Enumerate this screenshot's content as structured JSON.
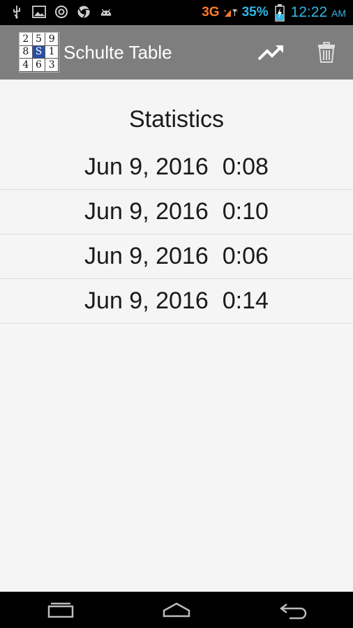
{
  "status_bar": {
    "network": "3G",
    "battery_percent": "35%",
    "time": "12:22",
    "ampm": "AM",
    "icons": [
      "usb-icon",
      "image-icon",
      "at-icon",
      "chrome-icon",
      "android-icon",
      "signal-icon",
      "battery-icon"
    ]
  },
  "action_bar": {
    "title": "Schulte Table",
    "logo_digits": [
      "2",
      "5",
      "9",
      "8",
      "S",
      "1",
      "4",
      "6",
      "3"
    ],
    "actions": [
      "chart-icon",
      "trash-icon"
    ]
  },
  "stats": {
    "heading": "Statistics",
    "rows": [
      {
        "date": "Jun 9, 2016",
        "time": "0:08"
      },
      {
        "date": "Jun 9, 2016",
        "time": "0:10"
      },
      {
        "date": "Jun 9, 2016",
        "time": "0:06"
      },
      {
        "date": "Jun 9, 2016",
        "time": "0:14"
      }
    ]
  },
  "nav_bar": {
    "buttons": [
      "recent-apps-icon",
      "home-icon",
      "back-icon"
    ]
  }
}
